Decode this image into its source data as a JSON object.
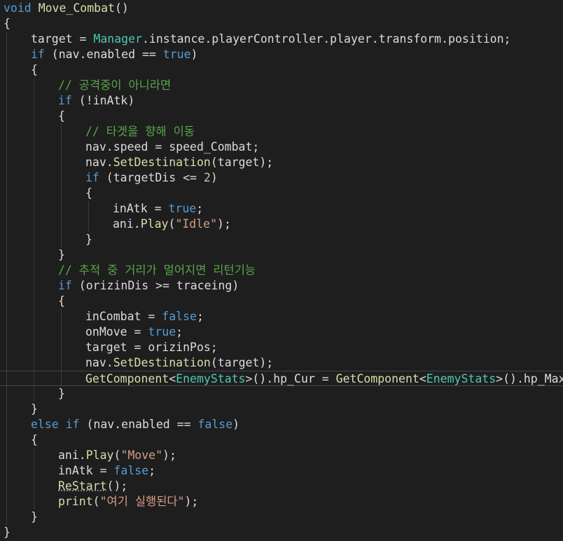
{
  "editor": {
    "language": "C#",
    "theme": "dark",
    "current_line_index": 24,
    "lines": [
      {
        "indent": 0,
        "tokens": [
          {
            "t": "void",
            "c": "kw"
          },
          {
            "t": " "
          },
          {
            "t": "Move_Combat",
            "c": "meth"
          },
          {
            "t": "()"
          }
        ]
      },
      {
        "indent": 0,
        "tokens": [
          {
            "t": "{"
          }
        ]
      },
      {
        "indent": 1,
        "tokens": [
          {
            "t": "target = "
          },
          {
            "t": "Manager",
            "c": "type"
          },
          {
            "t": ".instance.playerController.player.transform.position;"
          }
        ]
      },
      {
        "indent": 1,
        "tokens": [
          {
            "t": "if",
            "c": "kw"
          },
          {
            "t": " (nav.enabled == "
          },
          {
            "t": "true",
            "c": "kw"
          },
          {
            "t": ")"
          }
        ]
      },
      {
        "indent": 1,
        "tokens": [
          {
            "t": "{"
          }
        ]
      },
      {
        "indent": 2,
        "tokens": [
          {
            "t": "// 공격중이 아니라면",
            "c": "cmt"
          }
        ]
      },
      {
        "indent": 2,
        "tokens": [
          {
            "t": "if",
            "c": "kw"
          },
          {
            "t": " (!inAtk)"
          }
        ]
      },
      {
        "indent": 2,
        "tokens": [
          {
            "t": "{"
          }
        ]
      },
      {
        "indent": 3,
        "tokens": [
          {
            "t": "// 타겟을 향해 이동",
            "c": "cmt"
          }
        ]
      },
      {
        "indent": 3,
        "tokens": [
          {
            "t": "nav.speed = speed_Combat;"
          }
        ]
      },
      {
        "indent": 3,
        "tokens": [
          {
            "t": "nav."
          },
          {
            "t": "SetDestination",
            "c": "meth"
          },
          {
            "t": "(target);"
          }
        ]
      },
      {
        "indent": 3,
        "tokens": [
          {
            "t": "if",
            "c": "kw"
          },
          {
            "t": " (targetDis <= "
          },
          {
            "t": "2",
            "c": "num"
          },
          {
            "t": ")"
          }
        ]
      },
      {
        "indent": 3,
        "tokens": [
          {
            "t": "{"
          }
        ]
      },
      {
        "indent": 4,
        "tokens": [
          {
            "t": "inAtk = "
          },
          {
            "t": "true",
            "c": "kw"
          },
          {
            "t": ";"
          }
        ]
      },
      {
        "indent": 4,
        "tokens": [
          {
            "t": "ani."
          },
          {
            "t": "Play",
            "c": "meth"
          },
          {
            "t": "("
          },
          {
            "t": "\"Idle\"",
            "c": "str"
          },
          {
            "t": ");"
          }
        ]
      },
      {
        "indent": 3,
        "tokens": [
          {
            "t": "}"
          }
        ]
      },
      {
        "indent": 2,
        "tokens": [
          {
            "t": "}"
          }
        ]
      },
      {
        "indent": 2,
        "tokens": [
          {
            "t": "// 추적 중 거리가 멀어지면 리턴기능",
            "c": "cmt"
          }
        ]
      },
      {
        "indent": 2,
        "tokens": [
          {
            "t": "if",
            "c": "kw"
          },
          {
            "t": " (orizinDis >= traceing)"
          }
        ]
      },
      {
        "indent": 2,
        "tokens": [
          {
            "t": "{"
          }
        ]
      },
      {
        "indent": 3,
        "tokens": [
          {
            "t": "inCombat = "
          },
          {
            "t": "false",
            "c": "kw"
          },
          {
            "t": ";"
          }
        ]
      },
      {
        "indent": 3,
        "tokens": [
          {
            "t": "onMove = "
          },
          {
            "t": "true",
            "c": "kw"
          },
          {
            "t": ";"
          }
        ]
      },
      {
        "indent": 3,
        "tokens": [
          {
            "t": "target = orizinPos;"
          }
        ]
      },
      {
        "indent": 3,
        "tokens": [
          {
            "t": "nav."
          },
          {
            "t": "SetDestination",
            "c": "meth"
          },
          {
            "t": "(target);"
          }
        ]
      },
      {
        "indent": 3,
        "tokens": [
          {
            "t": "GetComponent",
            "c": "meth"
          },
          {
            "t": "<"
          },
          {
            "t": "EnemyStats",
            "c": "type"
          },
          {
            "t": ">().hp_Cur = "
          },
          {
            "t": "GetComponent",
            "c": "meth"
          },
          {
            "t": "<"
          },
          {
            "t": "EnemyStats",
            "c": "type"
          },
          {
            "t": ">().hp_Max;"
          }
        ]
      },
      {
        "indent": 2,
        "tokens": [
          {
            "t": "}"
          }
        ]
      },
      {
        "indent": 1,
        "tokens": [
          {
            "t": "}"
          }
        ]
      },
      {
        "indent": 1,
        "tokens": [
          {
            "t": "else",
            "c": "kw"
          },
          {
            "t": " "
          },
          {
            "t": "if",
            "c": "kw"
          },
          {
            "t": " (nav.enabled == "
          },
          {
            "t": "false",
            "c": "kw"
          },
          {
            "t": ")"
          }
        ]
      },
      {
        "indent": 1,
        "tokens": [
          {
            "t": "{"
          }
        ]
      },
      {
        "indent": 2,
        "tokens": [
          {
            "t": "ani."
          },
          {
            "t": "Play",
            "c": "meth"
          },
          {
            "t": "("
          },
          {
            "t": "\"Move\"",
            "c": "str"
          },
          {
            "t": ");"
          }
        ]
      },
      {
        "indent": 2,
        "tokens": [
          {
            "t": "inAtk = "
          },
          {
            "t": "false",
            "c": "kw"
          },
          {
            "t": ";"
          }
        ]
      },
      {
        "indent": 2,
        "tokens": [
          {
            "t": "ReStart",
            "c": "meth squig"
          },
          {
            "t": "();"
          }
        ]
      },
      {
        "indent": 2,
        "tokens": [
          {
            "t": "print",
            "c": "meth"
          },
          {
            "t": "("
          },
          {
            "t": "\"여기 실행된다\"",
            "c": "str"
          },
          {
            "t": ");"
          }
        ]
      },
      {
        "indent": 1,
        "tokens": [
          {
            "t": "}"
          }
        ]
      },
      {
        "indent": 0,
        "tokens": [
          {
            "t": "}"
          }
        ]
      }
    ]
  }
}
